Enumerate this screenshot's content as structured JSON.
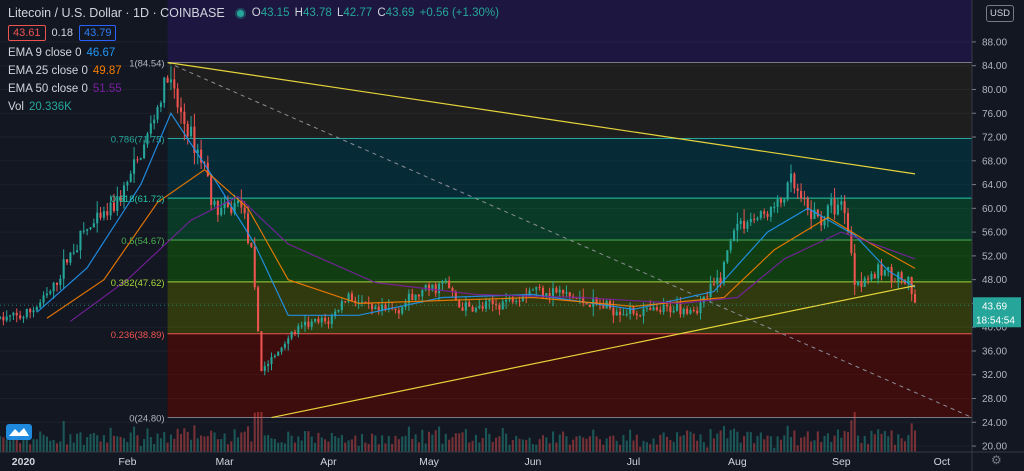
{
  "header": {
    "symbol_title": "Litecoin / U.S. Dollar · 1D · COINBASE",
    "ohlc": [
      {
        "key": "O",
        "value": "43.15"
      },
      {
        "key": "H",
        "value": "43.78"
      },
      {
        "key": "L",
        "value": "42.77"
      },
      {
        "key": "C",
        "value": "43.69"
      },
      {
        "key": "",
        "value": "+0.56 (+1.30%)"
      }
    ],
    "bid": "43.61",
    "spread": "0.18",
    "ask": "43.79"
  },
  "studies": [
    {
      "label": "EMA 9 close 0",
      "value": "46.67",
      "color": "#2196f3"
    },
    {
      "label": "EMA 25 close 0",
      "value": "49.87",
      "color": "#f57c00"
    },
    {
      "label": "EMA 50 close 0",
      "value": "51.55",
      "color": "#7b1fa2"
    },
    {
      "label": "Vol",
      "value": "20.336K",
      "color": "#26a69a"
    }
  ],
  "currency_label": "USD",
  "colors": {
    "background": "#131722",
    "up": "#26a69a",
    "down": "#ef5350",
    "trendline": "#e6d43a",
    "grid_text": "#b2b5be"
  },
  "chart_data": {
    "type": "candlestick",
    "price_axis": {
      "ticks": [
        "88.00",
        "84.00",
        "80.00",
        "76.00",
        "72.00",
        "68.00",
        "64.00",
        "60.00",
        "56.00",
        "52.00",
        "48.00",
        "44.00",
        "40.00",
        "36.00",
        "32.00",
        "28.00",
        "24.00",
        "20.00"
      ],
      "range": [
        19,
        89
      ]
    },
    "time_axis": {
      "labels": [
        {
          "label": "2020",
          "date": "2020-01-01"
        },
        {
          "label": "Feb",
          "date": "2020-02-01"
        },
        {
          "label": "Mar",
          "date": "2020-03-01"
        },
        {
          "label": "Apr",
          "date": "2020-04-01"
        },
        {
          "label": "May",
          "date": "2020-05-01"
        },
        {
          "label": "Jun",
          "date": "2020-06-01"
        },
        {
          "label": "Jul",
          "date": "2020-07-01"
        },
        {
          "label": "Aug",
          "date": "2020-08-01"
        },
        {
          "label": "Sep",
          "date": "2020-09-01"
        },
        {
          "label": "Oct",
          "date": "2020-10-01"
        }
      ],
      "range": [
        "2019-12-25",
        "2020-10-10"
      ]
    },
    "last_price": {
      "value": "43.69",
      "countdown": "18:54:54"
    },
    "fibonacci": {
      "start_date": "2020-02-13",
      "end_date": "2020-10-10",
      "levels": [
        {
          "ratio": "1",
          "price": 84.54,
          "label": "1(84.54)",
          "color": "#787b86",
          "fill": "#1e1e1e"
        },
        {
          "ratio": "0.786",
          "price": 71.75,
          "label": "0.786(71.75)",
          "color": "#26a69a",
          "fill": "#062a36"
        },
        {
          "ratio": "0.618",
          "price": 61.72,
          "label": "0.618(61.72)",
          "color": "#26c6a6",
          "fill": "#093a28"
        },
        {
          "ratio": "0.5",
          "price": 54.67,
          "label": "0.5(54.67)",
          "color": "#4caf50",
          "fill": "#103e12"
        },
        {
          "ratio": "0.382",
          "price": 47.62,
          "label": "0.382(47.62)",
          "color": "#a5d63a",
          "fill": "#303a0e"
        },
        {
          "ratio": "0.236",
          "price": 38.89,
          "label": "0.236(38.89)",
          "color": "#ef5350",
          "fill": "#3d0c0c"
        },
        {
          "ratio": "0",
          "price": 24.8,
          "label": "0(24.80)",
          "color": "#787b86",
          "fill": null
        }
      ],
      "top_band_fill": "#1c1640",
      "diagonal": {
        "from": [
          "2020-02-13",
          84.54
        ],
        "to": [
          "2020-10-10",
          24.8
        ]
      }
    },
    "trendlines": [
      {
        "from": [
          "2020-02-13",
          84.54
        ],
        "to": [
          "2020-09-23",
          65.8
        ]
      },
      {
        "from": [
          "2020-03-15",
          24.8
        ],
        "to": [
          "2020-09-23",
          47.0
        ]
      }
    ],
    "price_path": [
      [
        "2019-12-25",
        41.4
      ],
      [
        "2020-01-01",
        41.8
      ],
      [
        "2020-01-05",
        43.5
      ],
      [
        "2020-01-10",
        46.5
      ],
      [
        "2020-01-14",
        51.5
      ],
      [
        "2020-01-19",
        56.0
      ],
      [
        "2020-01-24",
        58.0
      ],
      [
        "2020-01-30",
        62.0
      ],
      [
        "2020-02-05",
        69.0
      ],
      [
        "2020-02-10",
        77.0
      ],
      [
        "2020-02-13",
        82.0
      ],
      [
        "2020-02-16",
        77.0
      ],
      [
        "2020-02-20",
        72.0
      ],
      [
        "2020-02-24",
        67.5
      ],
      [
        "2020-02-27",
        60.0
      ],
      [
        "2020-03-02",
        59.5
      ],
      [
        "2020-03-06",
        61.5
      ],
      [
        "2020-03-09",
        52.0
      ],
      [
        "2020-03-12",
        33.0
      ],
      [
        "2020-03-16",
        35.0
      ],
      [
        "2020-03-20",
        38.5
      ],
      [
        "2020-03-26",
        40.5
      ],
      [
        "2020-04-01",
        41.0
      ],
      [
        "2020-04-07",
        45.5
      ],
      [
        "2020-04-14",
        42.5
      ],
      [
        "2020-04-21",
        43.0
      ],
      [
        "2020-04-28",
        45.5
      ],
      [
        "2020-05-06",
        47.5
      ],
      [
        "2020-05-10",
        43.5
      ],
      [
        "2020-05-15",
        43.0
      ],
      [
        "2020-05-22",
        44.0
      ],
      [
        "2020-06-01",
        46.5
      ],
      [
        "2020-06-08",
        46.0
      ],
      [
        "2020-06-15",
        44.5
      ],
      [
        "2020-06-22",
        43.5
      ],
      [
        "2020-07-01",
        42.5
      ],
      [
        "2020-07-08",
        42.5
      ],
      [
        "2020-07-14",
        43.5
      ],
      [
        "2020-07-20",
        43.0
      ],
      [
        "2020-07-27",
        48.5
      ],
      [
        "2020-07-31",
        57.0
      ],
      [
        "2020-08-04",
        58.0
      ],
      [
        "2020-08-08",
        58.5
      ],
      [
        "2020-08-14",
        61.0
      ],
      [
        "2020-08-17",
        64.5
      ],
      [
        "2020-08-21",
        60.0
      ],
      [
        "2020-08-26",
        58.0
      ],
      [
        "2020-08-29",
        60.5
      ],
      [
        "2020-09-02",
        60.5
      ],
      [
        "2020-09-05",
        48.0
      ],
      [
        "2020-09-10",
        48.5
      ],
      [
        "2020-09-14",
        49.5
      ],
      [
        "2020-09-18",
        48.5
      ],
      [
        "2020-09-21",
        47.0
      ],
      [
        "2020-09-23",
        43.7
      ]
    ],
    "ema_paths": {
      "ema9": [
        [
          "2020-01-05",
          42.5
        ],
        [
          "2020-01-20",
          50.0
        ],
        [
          "2020-02-05",
          64.0
        ],
        [
          "2020-02-14",
          76.0
        ],
        [
          "2020-02-28",
          64.0
        ],
        [
          "2020-03-10",
          54.0
        ],
        [
          "2020-03-20",
          42.0
        ],
        [
          "2020-04-10",
          42.0
        ],
        [
          "2020-05-05",
          45.0
        ],
        [
          "2020-06-01",
          45.5
        ],
        [
          "2020-07-01",
          43.0
        ],
        [
          "2020-07-25",
          46.0
        ],
        [
          "2020-08-10",
          56.0
        ],
        [
          "2020-08-22",
          60.0
        ],
        [
          "2020-09-05",
          55.5
        ],
        [
          "2020-09-15",
          49.5
        ],
        [
          "2020-09-23",
          46.7
        ]
      ],
      "ema25": [
        [
          "2020-01-08",
          41.5
        ],
        [
          "2020-01-25",
          48.0
        ],
        [
          "2020-02-10",
          61.0
        ],
        [
          "2020-02-24",
          66.5
        ],
        [
          "2020-03-08",
          60.0
        ],
        [
          "2020-03-20",
          48.0
        ],
        [
          "2020-04-10",
          44.0
        ],
        [
          "2020-05-05",
          44.5
        ],
        [
          "2020-06-01",
          45.0
        ],
        [
          "2020-07-01",
          43.5
        ],
        [
          "2020-07-28",
          45.0
        ],
        [
          "2020-08-12",
          53.0
        ],
        [
          "2020-08-28",
          58.5
        ],
        [
          "2020-09-10",
          54.0
        ],
        [
          "2020-09-23",
          49.9
        ]
      ],
      "ema50": [
        [
          "2020-01-15",
          41.0
        ],
        [
          "2020-02-01",
          48.0
        ],
        [
          "2020-02-20",
          58.0
        ],
        [
          "2020-03-05",
          62.0
        ],
        [
          "2020-03-20",
          54.0
        ],
        [
          "2020-04-15",
          47.5
        ],
        [
          "2020-05-15",
          45.5
        ],
        [
          "2020-06-15",
          45.0
        ],
        [
          "2020-07-15",
          44.0
        ],
        [
          "2020-08-01",
          45.0
        ],
        [
          "2020-08-15",
          51.5
        ],
        [
          "2020-09-01",
          56.0
        ],
        [
          "2020-09-23",
          51.5
        ]
      ]
    }
  }
}
